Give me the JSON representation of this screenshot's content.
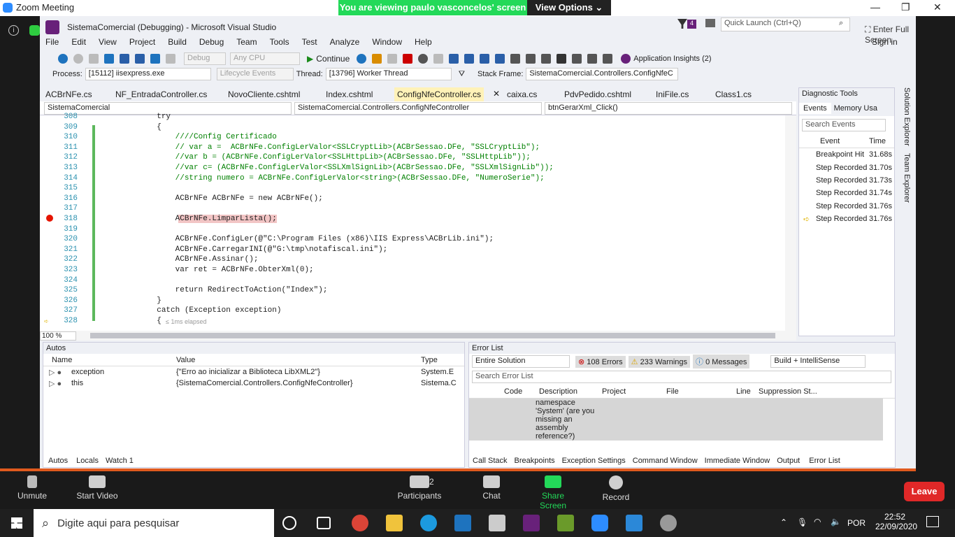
{
  "zoom": {
    "title": "Zoom Meeting",
    "viewing_banner": "You are viewing paulo vasconcelos' screen",
    "view_options": "View Options",
    "enter_fullscreen": "Enter Full Screen",
    "bottom": {
      "unmute": "Unmute",
      "start_video": "Start Video",
      "participants": "Participants",
      "participants_count": "2",
      "chat": "Chat",
      "share_screen": "Share Screen",
      "record": "Record",
      "leave": "Leave"
    }
  },
  "vs": {
    "title": "SistemaComercial (Debugging) - Microsoft Visual Studio",
    "quick_launch_placeholder": "Quick Launch (Ctrl+Q)",
    "notif_count": "4",
    "sign_in": "Sign in",
    "menu": [
      "File",
      "Edit",
      "View",
      "Project",
      "Build",
      "Debug",
      "Team",
      "Tools",
      "Test",
      "Analyze",
      "Window",
      "Help"
    ],
    "toolbar": {
      "debug": "Debug",
      "cpu": "Any CPU",
      "continue": "Continue",
      "app_insights": "Application Insights (2)"
    },
    "debugbar": {
      "process_label": "Process:",
      "process": "[15112] iisexpress.exe",
      "lifecycle": "Lifecycle Events",
      "thread_label": "Thread:",
      "thread": "[13796] Worker Thread",
      "stack_label": "Stack Frame:",
      "stack": "SistemaComercial.Controllers.ConfigNfeC"
    },
    "tabs": [
      "ACBrNFe.cs",
      "NF_EntradaController.cs",
      "NovoCliente.cshtml",
      "Index.cshtml",
      "ConfigNfeController.cs",
      "caixa.cs",
      "PdvPedido.cshtml",
      "IniFile.cs",
      "Class1.cs"
    ],
    "nav": {
      "project": "SistemaComercial",
      "class": "SistemaComercial.Controllers.ConfigNfeController",
      "member": "btnGerarXml_Click()"
    },
    "zoom_level": "100 %",
    "elapsed": "≤ 1ms elapsed",
    "code": [
      {
        "n": "308",
        "t": "            try"
      },
      {
        "n": "309",
        "t": "            {"
      },
      {
        "n": "310",
        "t": "                ////Config Certificado"
      },
      {
        "n": "311",
        "t": "                // var a =  ACBrNFe.ConfigLerValor<SSLCryptLib>(ACBrSessao.DFe, \"SSLCryptLib\");"
      },
      {
        "n": "312",
        "t": "                //var b = (ACBrNFe.ConfigLerValor<SSLHttpLib>(ACBrSessao.DFe, \"SSLHttpLib\"));"
      },
      {
        "n": "313",
        "t": "                //var c= (ACBrNFe.ConfigLerValor<SSLXmlSignLib>(ACBrSessao.DFe, \"SSLXmlSignLib\"));"
      },
      {
        "n": "314",
        "t": "                //string numero = ACBrNFe.ConfigLerValor<string>(ACBrSessao.DFe, \"NumeroSerie\");"
      },
      {
        "n": "315",
        "t": ""
      },
      {
        "n": "316",
        "t": "                ACBrNFe ACBrNFe = new ACBrNFe();"
      },
      {
        "n": "317",
        "t": ""
      },
      {
        "n": "318",
        "t": "                ACBrNFe.LimparLista();"
      },
      {
        "n": "319",
        "t": ""
      },
      {
        "n": "320",
        "t": "                ACBrNFe.ConfigLer(@\"C:\\Program Files (x86)\\IIS Express\\ACBrLib.ini\");"
      },
      {
        "n": "321",
        "t": "                ACBrNFe.CarregarINI(@\"G:\\tmp\\notafiscal.ini\");"
      },
      {
        "n": "322",
        "t": "                ACBrNFe.Assinar();"
      },
      {
        "n": "323",
        "t": "                var ret = ACBrNFe.ObterXml(0);"
      },
      {
        "n": "324",
        "t": ""
      },
      {
        "n": "325",
        "t": "                return RedirectToAction(\"Index\");"
      },
      {
        "n": "326",
        "t": "            }"
      },
      {
        "n": "327",
        "t": "            catch (Exception exception)"
      },
      {
        "n": "328",
        "t": "            {"
      }
    ],
    "diagnostic": {
      "title": "Diagnostic Tools",
      "tab_events": "Events",
      "tab_memory": "Memory Usa",
      "search_placeholder": "Search Events",
      "col_event": "Event",
      "col_time": "Time",
      "events": [
        {
          "e": "Breakpoint Hit",
          "t": "31.68s"
        },
        {
          "e": "Step Recorded",
          "t": "31.70s"
        },
        {
          "e": "Step Recorded",
          "t": "31.73s"
        },
        {
          "e": "Step Recorded",
          "t": "31.74s"
        },
        {
          "e": "Step Recorded",
          "t": "31.76s"
        },
        {
          "e": "Step Recorded",
          "t": "31.76s"
        }
      ]
    },
    "side_tabs": [
      "Solution Explorer",
      "Team Explorer"
    ],
    "autos": {
      "title": "Autos",
      "col_name": "Name",
      "col_value": "Value",
      "col_type": "Type",
      "rows": [
        {
          "name": "exception",
          "value": "{\"Erro ao inicializar a Biblioteca LibXML2\"}",
          "type": "System.E"
        },
        {
          "name": "this",
          "value": "{SistemaComercial.Controllers.ConfigNfeController}",
          "type": "Sistema.C"
        }
      ],
      "tabs": [
        "Autos",
        "Locals",
        "Watch 1"
      ]
    },
    "errorlist": {
      "title": "Error List",
      "scope": "Entire Solution",
      "errors": "108 Errors",
      "warnings": "233 Warnings",
      "messages": "0 Messages",
      "build": "Build + IntelliSense",
      "search_placeholder": "Search Error List",
      "cols": [
        "Code",
        "Description",
        "Project",
        "File",
        "Line",
        "Suppression St..."
      ],
      "desc": "namespace 'System' (are you missing an assembly reference?)",
      "tabs": [
        "Call Stack",
        "Breakpoints",
        "Exception Settings",
        "Command Window",
        "Immediate Window",
        "Output",
        "Error List"
      ]
    }
  },
  "taskbar": {
    "search_placeholder": "Digite aqui para pesquisar",
    "lang": "POR",
    "time": "22:52",
    "date": "22/09/2020"
  }
}
